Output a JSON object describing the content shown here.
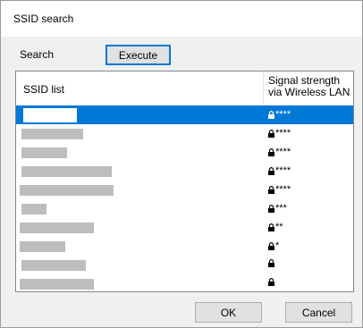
{
  "window": {
    "title": "SSID search"
  },
  "search": {
    "label": "Search",
    "execute_label": "Execute"
  },
  "table": {
    "col_ssid": "SSID list",
    "col_signal_line1": "Signal strength",
    "col_signal_line2": "via Wireless LAN",
    "rows": [
      {
        "signal": "****",
        "selected": true
      },
      {
        "signal": "****"
      },
      {
        "signal": "****"
      },
      {
        "signal": "****"
      },
      {
        "signal": "****"
      },
      {
        "signal": "***"
      },
      {
        "signal": "**"
      },
      {
        "signal": "*"
      },
      {
        "signal": ""
      },
      {
        "signal": ""
      }
    ]
  },
  "footer": {
    "ok_label": "OK",
    "cancel_label": "Cancel"
  },
  "icons": {
    "lock": "lock-icon"
  },
  "colors": {
    "selection": "#0078d7",
    "redacted": "#bdbdbd"
  }
}
